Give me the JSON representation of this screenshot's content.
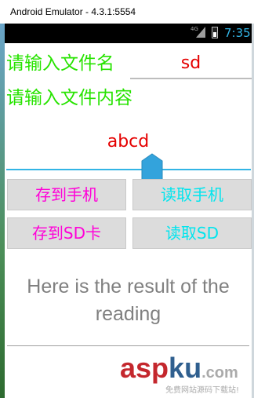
{
  "window": {
    "title": "Android Emulator - 4.3.1:5554"
  },
  "statusbar": {
    "network": "4G",
    "time": "7:35"
  },
  "form": {
    "filename_label": "请输入文件名",
    "filename_value": "sd",
    "content_label": "请输入文件内容",
    "content_value": "abcd"
  },
  "buttons": {
    "save_phone": "存到手机",
    "read_phone": "读取手机",
    "save_sd": "存到SD卡",
    "read_sd": "读取SD"
  },
  "result": {
    "text": "Here is the result of the reading"
  },
  "watermark": {
    "asp": "asp",
    "ku": "ku",
    "com": ".com",
    "sub": "免费网站源码下载站!"
  },
  "colors": {
    "label": "#27e300",
    "input_text": "#e50000",
    "btn_magenta": "#ff00d8",
    "btn_cyan": "#00e5ee",
    "accent": "#33b5e5"
  }
}
